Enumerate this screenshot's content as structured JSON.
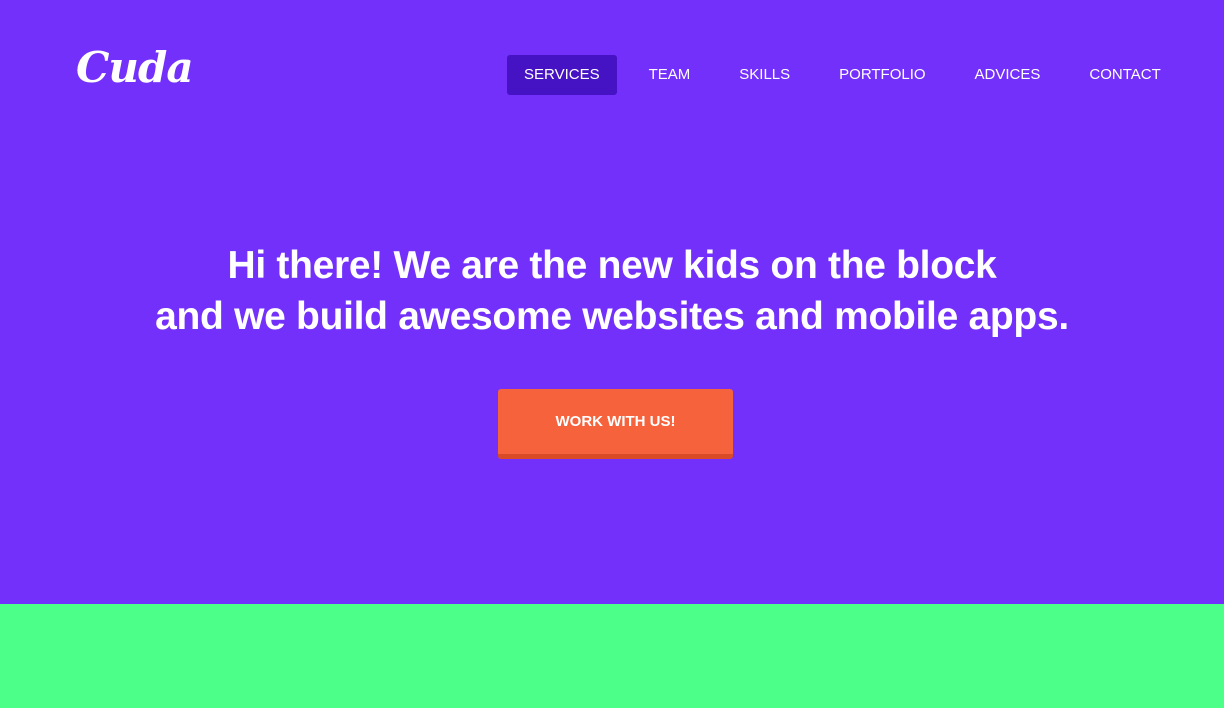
{
  "brand": {
    "logo_text": "Cuda"
  },
  "nav": {
    "items": [
      {
        "label": "SERVICES",
        "active": true
      },
      {
        "label": "TEAM"
      },
      {
        "label": "SKILLS"
      },
      {
        "label": "PORTFOLIO"
      },
      {
        "label": "ADVICES"
      },
      {
        "label": "CONTACT"
      }
    ]
  },
  "hero": {
    "headline_line1": "Hi there! We are the new kids on the block",
    "headline_line2": "and we build awesome websites and mobile apps.",
    "cta_label": "WORK WITH US!"
  },
  "colors": {
    "hero_bg": "#7430fb",
    "nav_active_bg": "#4512c4",
    "cta_bg": "#f5623c",
    "lower_section_bg": "#4bff88"
  }
}
